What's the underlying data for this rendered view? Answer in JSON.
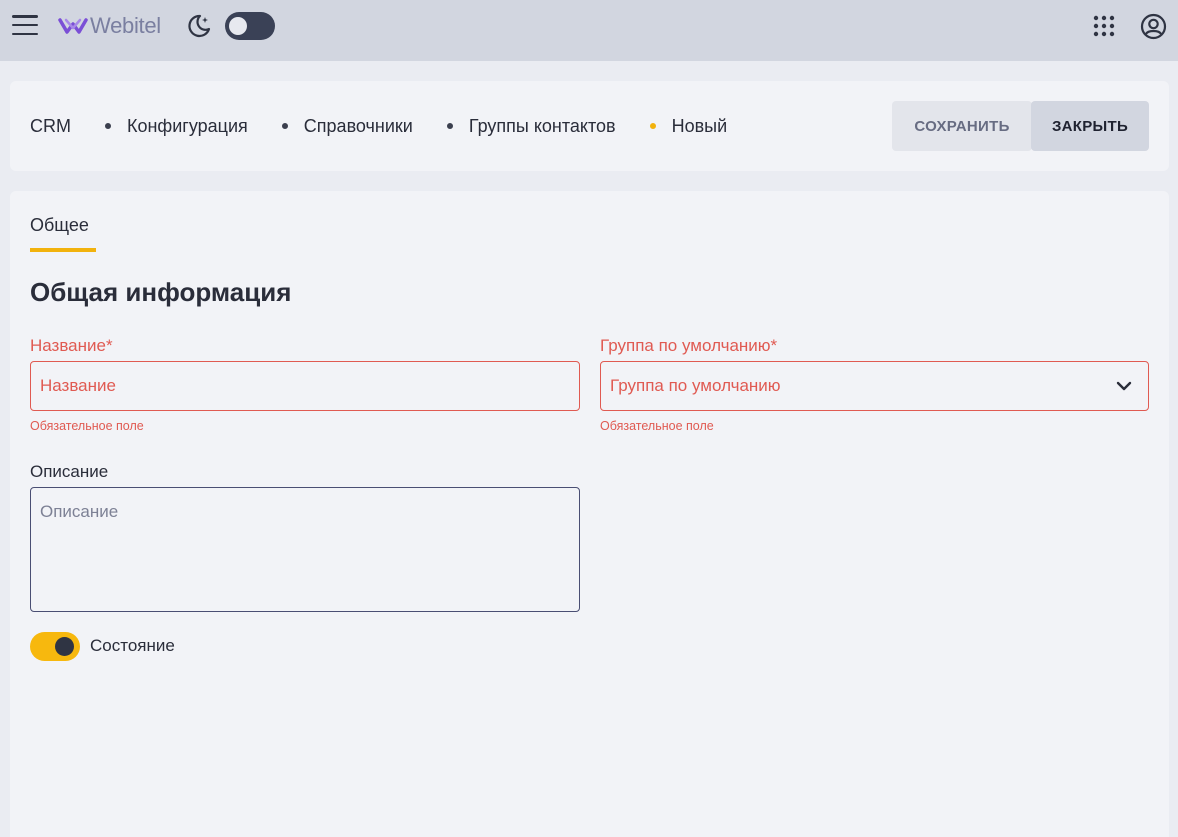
{
  "app": {
    "logo_text": "Webitel",
    "theme_dark": true
  },
  "breadcrumb": [
    {
      "label": "CRM"
    },
    {
      "label": "Конфигурация"
    },
    {
      "label": "Справочники"
    },
    {
      "label": "Группы контактов"
    },
    {
      "label": "Новый"
    }
  ],
  "actions": {
    "save_label": "СОХРАНИТЬ",
    "close_label": "ЗАКРЫТЬ"
  },
  "tabs": [
    {
      "label": "Общее",
      "active": true
    }
  ],
  "form": {
    "section_title": "Общая информация",
    "name": {
      "label": "Название*",
      "placeholder": "Название",
      "value": "",
      "error": "Обязательное поле"
    },
    "default_group": {
      "label": "Группа по умолчанию*",
      "placeholder": "Группа по умолчанию",
      "value": "",
      "error": "Обязательное поле"
    },
    "description": {
      "label": "Описание",
      "placeholder": "Описание",
      "value": ""
    },
    "state": {
      "label": "Состояние",
      "enabled": true
    }
  },
  "colors": {
    "accent": "#f7b80e",
    "error": "#e05a52",
    "topbar": "#d2d6e0",
    "logo": "#7b4fd6"
  },
  "icons": {
    "menu": "hamburger-icon",
    "theme": "moon-icon",
    "apps": "apps-grid-icon",
    "account": "account-icon",
    "select": "chevron-down-icon"
  }
}
